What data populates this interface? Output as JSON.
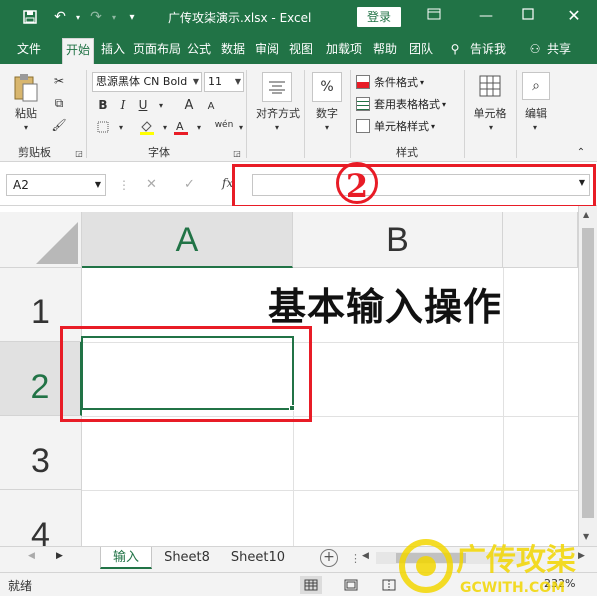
{
  "titlebar": {
    "title": "广传攻柒演示.xlsx - Excel",
    "login": "登录",
    "icons": [
      "save-icon",
      "undo-icon",
      "redo-icon",
      "customize-icon",
      "ribbon-display-icon",
      "minimize-icon",
      "maximize-icon",
      "close-icon"
    ]
  },
  "tabs": [
    "文件",
    "开始",
    "插入",
    "页面布局",
    "公式",
    "数据",
    "审阅",
    "视图",
    "加载项",
    "帮助",
    "团队"
  ],
  "tabs_extra": {
    "tell_me": "告诉我",
    "share": "共享"
  },
  "ribbon": {
    "clipboard": {
      "paste": "粘贴",
      "label": "剪贴板"
    },
    "font": {
      "font_name": "思源黑体 CN Bold",
      "font_size": "11",
      "bold": "B",
      "italic": "I",
      "underline": "U",
      "grow": "A",
      "shrink": "A",
      "phonetic": "wén",
      "label": "字体"
    },
    "alignment": {
      "label": "对齐方式"
    },
    "number": {
      "symbol": "%",
      "label": "数字"
    },
    "styles": {
      "conditional": "条件格式",
      "table": "套用表格格式",
      "cell": "单元格样式",
      "label": "样式"
    },
    "cells": {
      "label": "单元格"
    },
    "editing": {
      "label": "编辑"
    }
  },
  "formula_bar": {
    "name_box": "A2",
    "fx": "fx",
    "cancel": "✕",
    "enter": "✓",
    "value": ""
  },
  "annotation": {
    "marker": "2"
  },
  "grid": {
    "columns": [
      "A",
      "B"
    ],
    "rows": [
      "1",
      "2",
      "3",
      "4"
    ],
    "selected_cell": "A2",
    "heading": "基本输入操作"
  },
  "sheets": [
    "输入",
    "Sheet8",
    "Sheet10"
  ],
  "status": {
    "ready": "就绪",
    "zoom": "232%"
  },
  "watermark": {
    "text": "广传攻柒",
    "url": "GCWITH.COM"
  },
  "colors": {
    "accent": "#217346",
    "annotation_red": "#e81c26"
  }
}
